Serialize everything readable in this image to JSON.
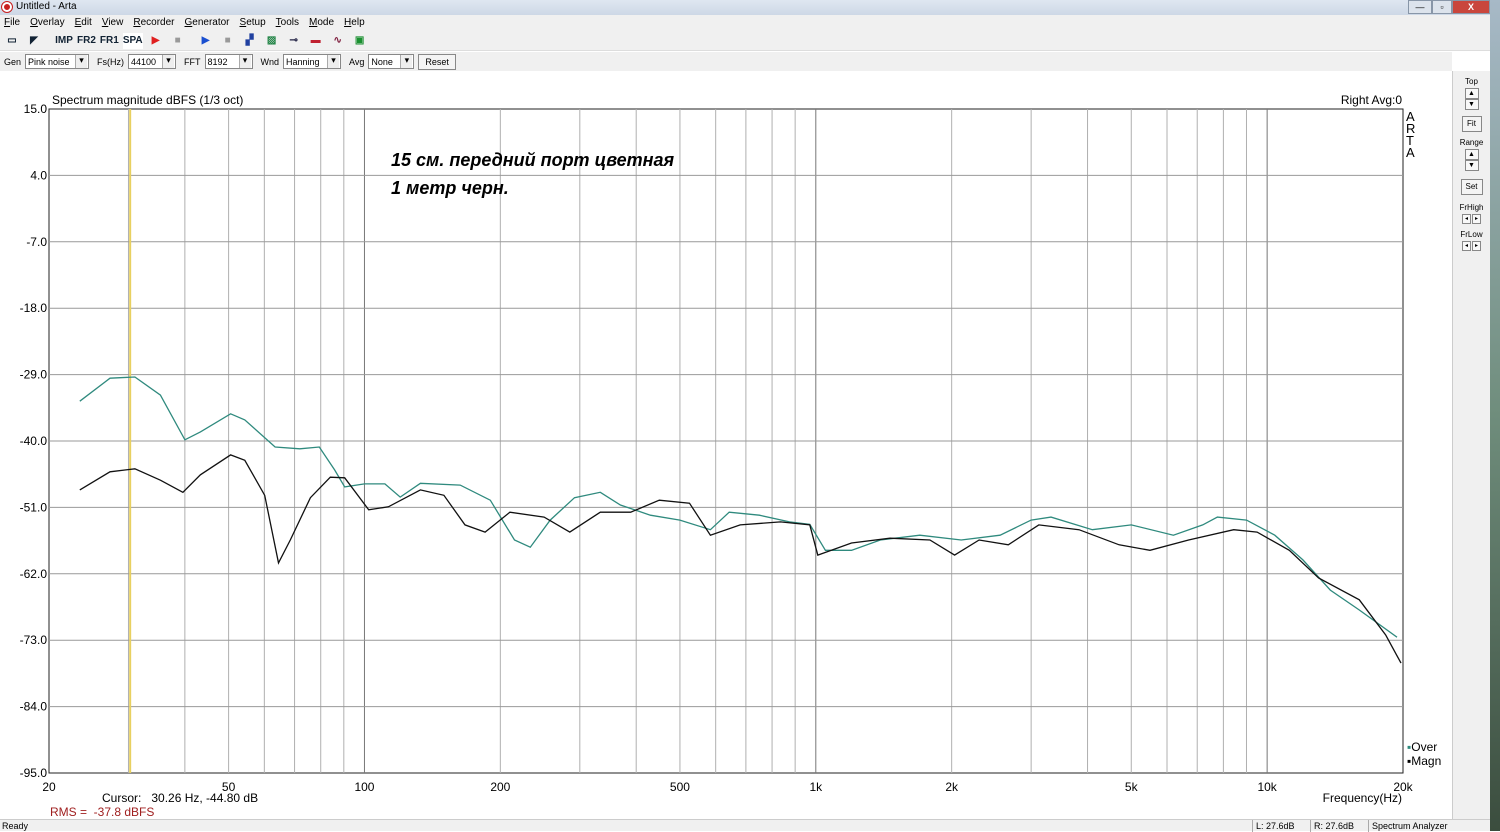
{
  "window": {
    "title": "Untitled - Arta",
    "min": "—",
    "max": "▫",
    "close": "X"
  },
  "menu": [
    "File",
    "Overlay",
    "Edit",
    "View",
    "Recorder",
    "Generator",
    "Setup",
    "Tools",
    "Mode",
    "Help"
  ],
  "toolbar": {
    "imp": "IMP",
    "fr2": "FR2",
    "fr1": "FR1",
    "spa": "SPA"
  },
  "params": {
    "gen_label": "Gen",
    "gen": "Pink noise",
    "fs_label": "Fs(Hz)",
    "fs": "44100",
    "fft_label": "FFT",
    "fft": "8192",
    "wnd_label": "Wnd",
    "wnd": "Hanning",
    "avg_label": "Avg",
    "avg": "None",
    "reset": "Reset"
  },
  "side": {
    "top": "Top",
    "fit": "Fit",
    "range": "Range",
    "set": "Set",
    "frhigh": "FrHigh",
    "frlow": "FrLow"
  },
  "readout": {
    "cursor": "Cursor:   30.26 Hz, -44.80 dB",
    "rms": "RMS =  -37.8 dBFS"
  },
  "status": {
    "ready": "Ready",
    "l": "L: 27.6dB",
    "r": "R: 27.6dB",
    "mode": "Spectrum Analyzer"
  },
  "colors": {
    "over": "#2f8a7e",
    "magn": "#111111",
    "cursor": "#e8d060",
    "grid": "#a0a0a0"
  },
  "chart_data": {
    "type": "line",
    "title": "Spectrum magnitude dBFS (1/3 oct)",
    "top_right": "Right  Avg:0",
    "watermark": "ARTA",
    "annotation": [
      "15 см. передний порт цветная",
      "1 метр черн."
    ],
    "xlabel": "Frequency(Hz)",
    "ylabel": "",
    "xscale": "log",
    "xlim": [
      20,
      20000
    ],
    "ylim": [
      -95,
      15
    ],
    "xticks": [
      20,
      50,
      100,
      200,
      500,
      1000,
      2000,
      5000,
      10000,
      20000
    ],
    "xtick_labels": [
      "20",
      "50",
      "100",
      "200",
      "500",
      "1k",
      "2k",
      "5k",
      "10k",
      "20k"
    ],
    "yticks": [
      15,
      4,
      -7,
      -18,
      -29,
      -40,
      -51,
      -62,
      -73,
      -84,
      -95
    ],
    "ytick_labels": [
      "15.0",
      "4.0",
      "-7.0",
      "-18.0",
      "-29.0",
      "-40.0",
      "-51.0",
      "-62.0",
      "-73.0",
      "-84.0",
      "-95.0"
    ],
    "grid": true,
    "legend": "bottom-right",
    "cursor_hz": 30.26,
    "series": [
      {
        "name": "Over",
        "color": "#2f8a7e",
        "points": [
          [
            23.4,
            -33.4
          ],
          [
            27.3,
            -29.6
          ],
          [
            31,
            -29.4
          ],
          [
            35.3,
            -32.4
          ],
          [
            40,
            -39.8
          ],
          [
            43.3,
            -38.5
          ],
          [
            50.5,
            -35.5
          ],
          [
            54.3,
            -36.5
          ],
          [
            63.4,
            -41.0
          ],
          [
            71.9,
            -41.3
          ],
          [
            79.4,
            -41.0
          ],
          [
            85.9,
            -44.8
          ],
          [
            90.4,
            -47.6
          ],
          [
            100,
            -47.1
          ],
          [
            111,
            -47.1
          ],
          [
            120,
            -49.3
          ],
          [
            133,
            -47.0
          ],
          [
            163,
            -47.3
          ],
          [
            190,
            -49.8
          ],
          [
            215,
            -56.4
          ],
          [
            233,
            -57.6
          ],
          [
            258,
            -53.1
          ],
          [
            292,
            -49.4
          ],
          [
            333,
            -48.5
          ],
          [
            369,
            -50.6
          ],
          [
            430,
            -52.3
          ],
          [
            500,
            -53.1
          ],
          [
            584,
            -54.7
          ],
          [
            643,
            -51.8
          ],
          [
            750,
            -52.3
          ],
          [
            875,
            -53.4
          ],
          [
            970,
            -53.8
          ],
          [
            1050,
            -58.1
          ],
          [
            1200,
            -58.1
          ],
          [
            1390,
            -56.4
          ],
          [
            1700,
            -55.6
          ],
          [
            2100,
            -56.4
          ],
          [
            2560,
            -55.6
          ],
          [
            3000,
            -53.1
          ],
          [
            3320,
            -52.6
          ],
          [
            4100,
            -54.7
          ],
          [
            5000,
            -53.9
          ],
          [
            6200,
            -55.6
          ],
          [
            7200,
            -53.9
          ],
          [
            7760,
            -52.6
          ],
          [
            9000,
            -53.1
          ],
          [
            10400,
            -55.6
          ],
          [
            12000,
            -59.7
          ],
          [
            13800,
            -64.7
          ],
          [
            16000,
            -68.0
          ],
          [
            19400,
            -72.5
          ]
        ]
      },
      {
        "name": "Magn",
        "color": "#111111",
        "points": [
          [
            23.4,
            -48.1
          ],
          [
            27.3,
            -45.1
          ],
          [
            31,
            -44.6
          ],
          [
            35.3,
            -46.5
          ],
          [
            39.6,
            -48.5
          ],
          [
            43.3,
            -45.6
          ],
          [
            50.5,
            -42.3
          ],
          [
            54.3,
            -43.2
          ],
          [
            60.1,
            -49.0
          ],
          [
            64.5,
            -60.2
          ],
          [
            68.5,
            -56.4
          ],
          [
            75.9,
            -49.4
          ],
          [
            84,
            -46.0
          ],
          [
            90.4,
            -46.1
          ],
          [
            102.2,
            -51.4
          ],
          [
            113,
            -50.9
          ],
          [
            133,
            -48.1
          ],
          [
            150,
            -49.0
          ],
          [
            167,
            -53.9
          ],
          [
            185,
            -55.1
          ],
          [
            210,
            -51.8
          ],
          [
            250,
            -52.6
          ],
          [
            285,
            -55.1
          ],
          [
            333,
            -51.8
          ],
          [
            389,
            -51.8
          ],
          [
            450,
            -49.8
          ],
          [
            525,
            -50.3
          ],
          [
            584,
            -55.6
          ],
          [
            680,
            -53.9
          ],
          [
            835,
            -53.4
          ],
          [
            970,
            -53.9
          ],
          [
            1010,
            -58.9
          ],
          [
            1200,
            -56.9
          ],
          [
            1460,
            -56.1
          ],
          [
            1790,
            -56.4
          ],
          [
            2030,
            -58.9
          ],
          [
            2300,
            -56.4
          ],
          [
            2670,
            -57.2
          ],
          [
            3120,
            -53.9
          ],
          [
            3830,
            -54.7
          ],
          [
            4700,
            -57.2
          ],
          [
            5500,
            -58.1
          ],
          [
            6700,
            -56.4
          ],
          [
            8430,
            -54.7
          ],
          [
            9500,
            -55.1
          ],
          [
            11200,
            -58.1
          ],
          [
            13000,
            -62.7
          ],
          [
            16000,
            -66.3
          ],
          [
            18300,
            -72.1
          ],
          [
            19800,
            -76.8
          ]
        ]
      }
    ]
  }
}
